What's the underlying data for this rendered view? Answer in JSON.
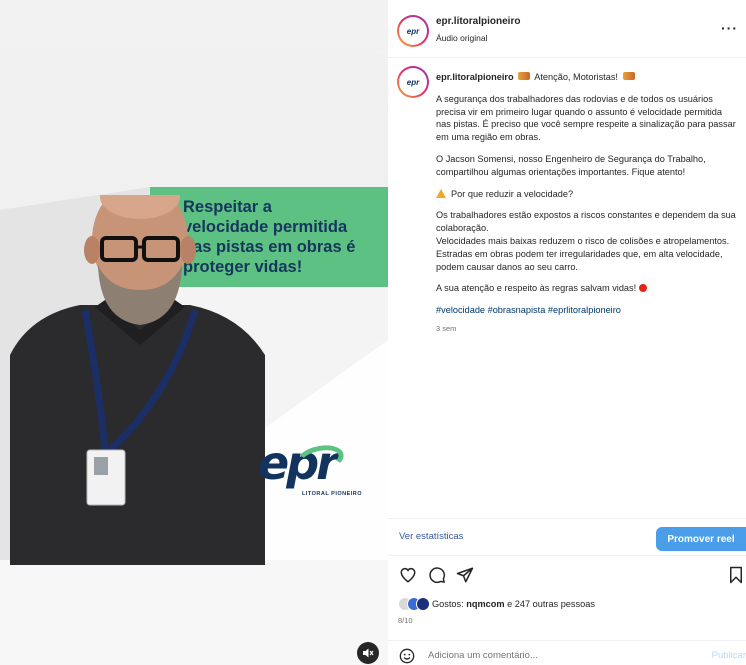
{
  "media": {
    "banner_lines": [
      "Respeitar a",
      "velocidade permitida",
      "das pistas em obras é",
      "proteger vidas!"
    ],
    "logo_text": "epr",
    "logo_subtext": "LITORAL PIONEIRO",
    "mute_icon": "speaker-muted-icon"
  },
  "post": {
    "username": "epr.litoralpioneiro",
    "audio_label": "Áudio original",
    "more_icon": "more-options-icon",
    "caption": {
      "username": "epr.litoralpioneiro",
      "title": "Atenção, Motoristas!",
      "p1": "A segurança dos trabalhadores das rodovias e de todos os usuários precisa vir em primeiro lugar quando o assunto é velocidade permitida nas pistas. É preciso que você sempre respeite a sinalização para passar em uma região em obras.",
      "p2": "O Jacson Somensi, nosso Engenheiro de Segurança do Trabalho, compartilhou algumas orientações importantes. Fique atento!",
      "p3": "Por que reduzir a velocidade?",
      "p4a": "Os trabalhadores estão expostos a riscos constantes e dependem da sua colaboração.",
      "p4b": "Velocidades mais baixas reduzem o risco de colisões e atropelamentos.",
      "p4c": "Estradas em obras podem ter irregularidades que, em alta velocidade, podem causar danos ao seu carro.",
      "p5": "A sua atenção e respeito às regras salvam vidas!",
      "hashtags": "#velocidade #obrasnapista #eprlitoralpioneiro",
      "timestamp": "3 sem"
    },
    "view_stats_label": "Ver estatísticas",
    "promote_label": "Promover reel",
    "likes_prefix": "Gostos: ",
    "likes_user": "nqmcom",
    "likes_suffix": " e 247 outras pessoas",
    "date": "8/10",
    "comment_placeholder": "Adiciona um comentário...",
    "publish_label": "Publicar"
  },
  "colors": {
    "banner_green": "#5ec184",
    "brand_navy": "#12335e",
    "promote_blue": "#4a9de8",
    "link_blue": "#385898"
  }
}
